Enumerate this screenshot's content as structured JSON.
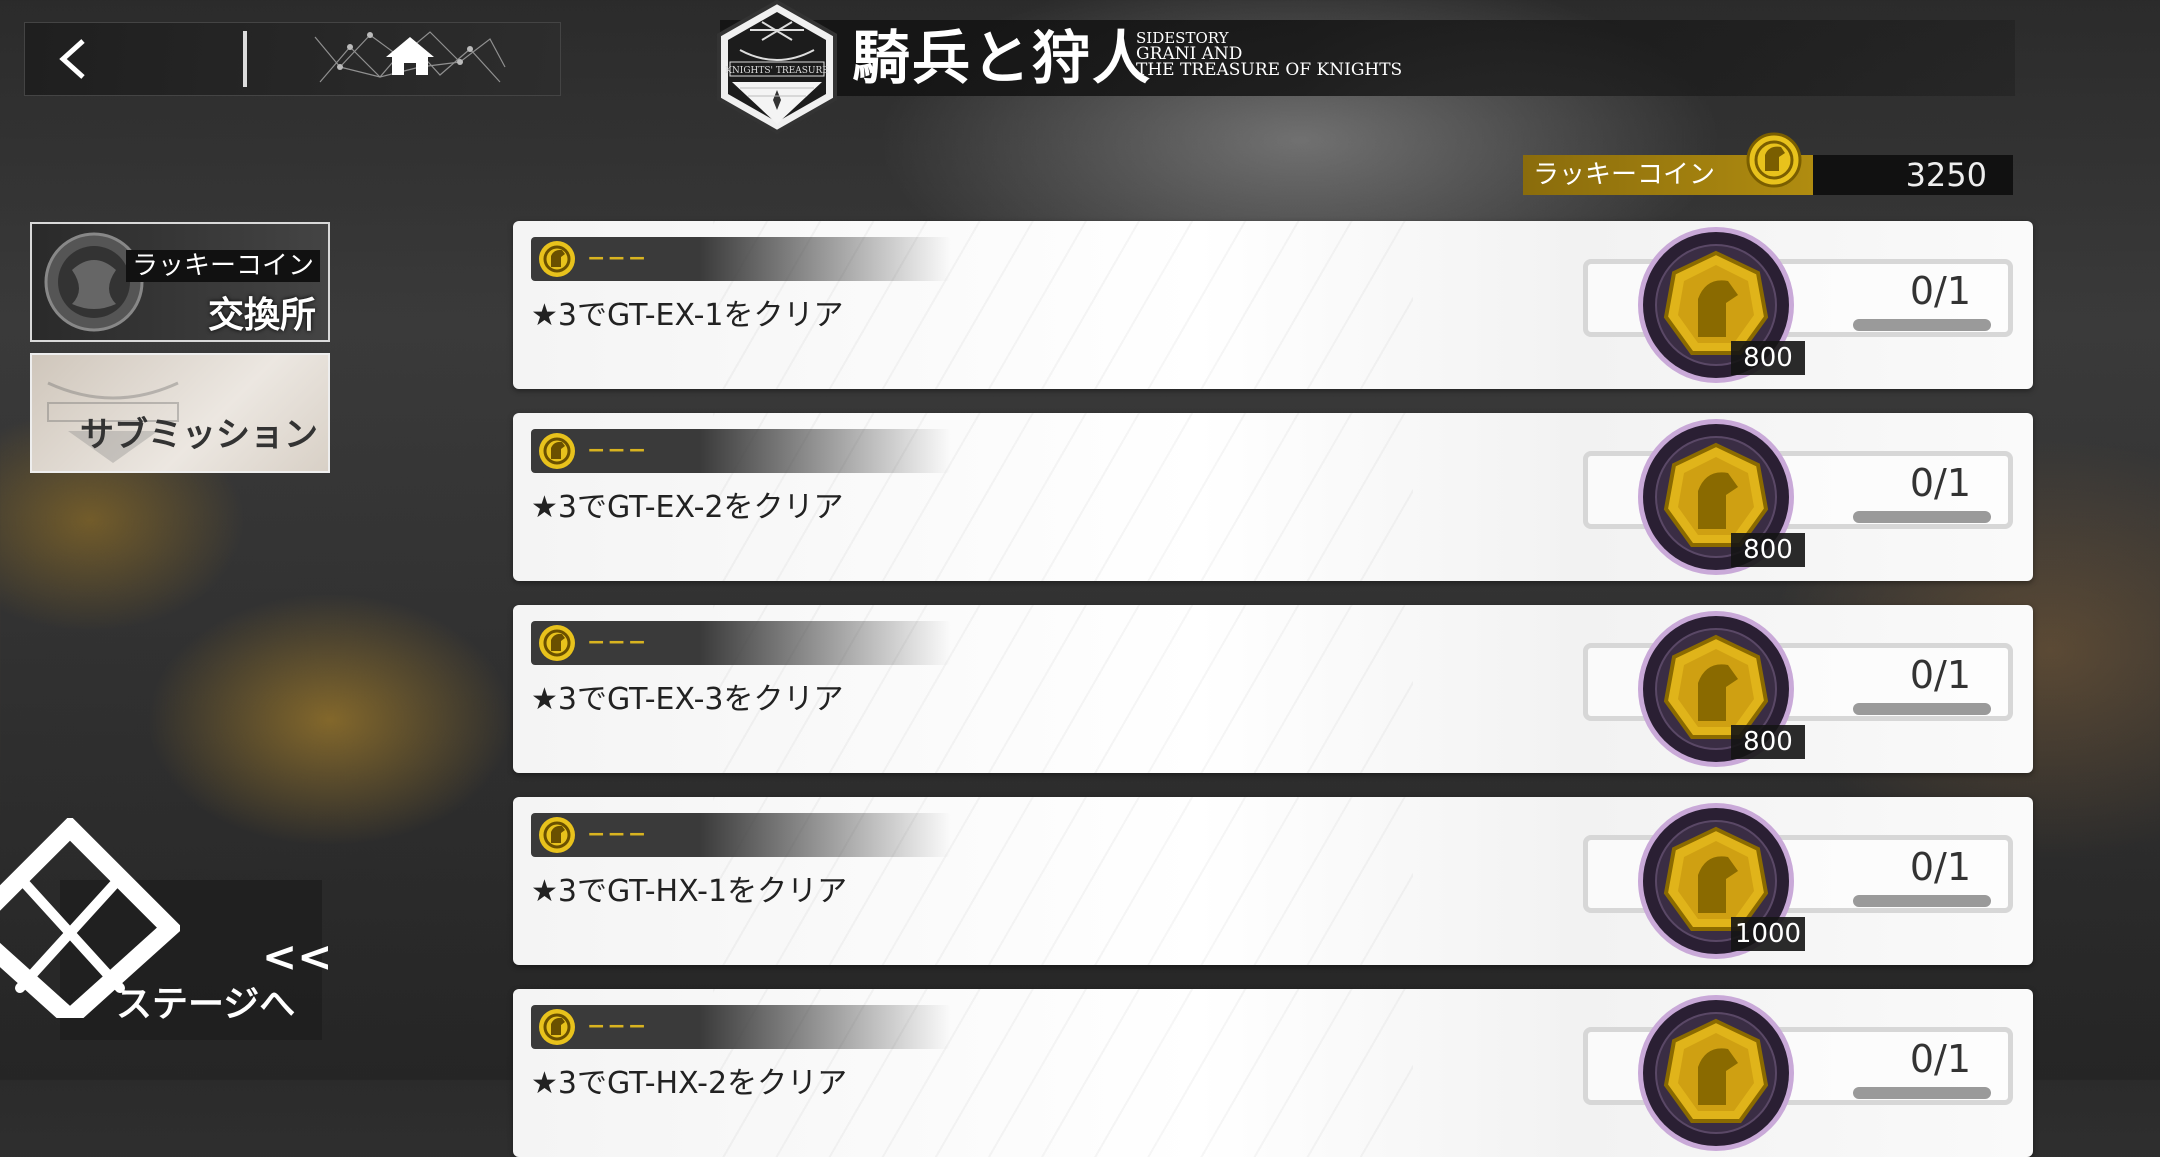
{
  "header": {
    "title_jp": "騎兵と狩人",
    "sidestory": "SIDESTORY",
    "subtitle_line1": "GRANI AND",
    "subtitle_line2": "THE TREASURE OF KNIGHTS",
    "emblem_text": "KNIGHTS' TREASURE"
  },
  "nav": {
    "back_icon": "chevron-left-icon",
    "home_icon": "home-icon"
  },
  "currency": {
    "label": "ラッキーコイン",
    "value": "3250",
    "icon": "horse-coin-icon",
    "accent": "#b08c10"
  },
  "sidebar": {
    "shop": {
      "line1": "ラッキーコイン",
      "line2": "交換所"
    },
    "submission": {
      "label": "サブミッション"
    }
  },
  "stage": {
    "chevron": "<<",
    "label": "ステージへ"
  },
  "missions": [
    {
      "tag": "−−−",
      "text": "★3でGT-EX-1をクリア",
      "progress": "0/1",
      "reward": "800"
    },
    {
      "tag": "−−−",
      "text": "★3でGT-EX-2をクリア",
      "progress": "0/1",
      "reward": "800"
    },
    {
      "tag": "−−−",
      "text": "★3でGT-EX-3をクリア",
      "progress": "0/1",
      "reward": "800"
    },
    {
      "tag": "−−−",
      "text": "★3でGT-HX-1をクリア",
      "progress": "0/1",
      "reward": "1000"
    },
    {
      "tag": "−−−",
      "text": "★3でGT-HX-2をクリア",
      "progress": "0/1",
      "reward": ""
    }
  ]
}
